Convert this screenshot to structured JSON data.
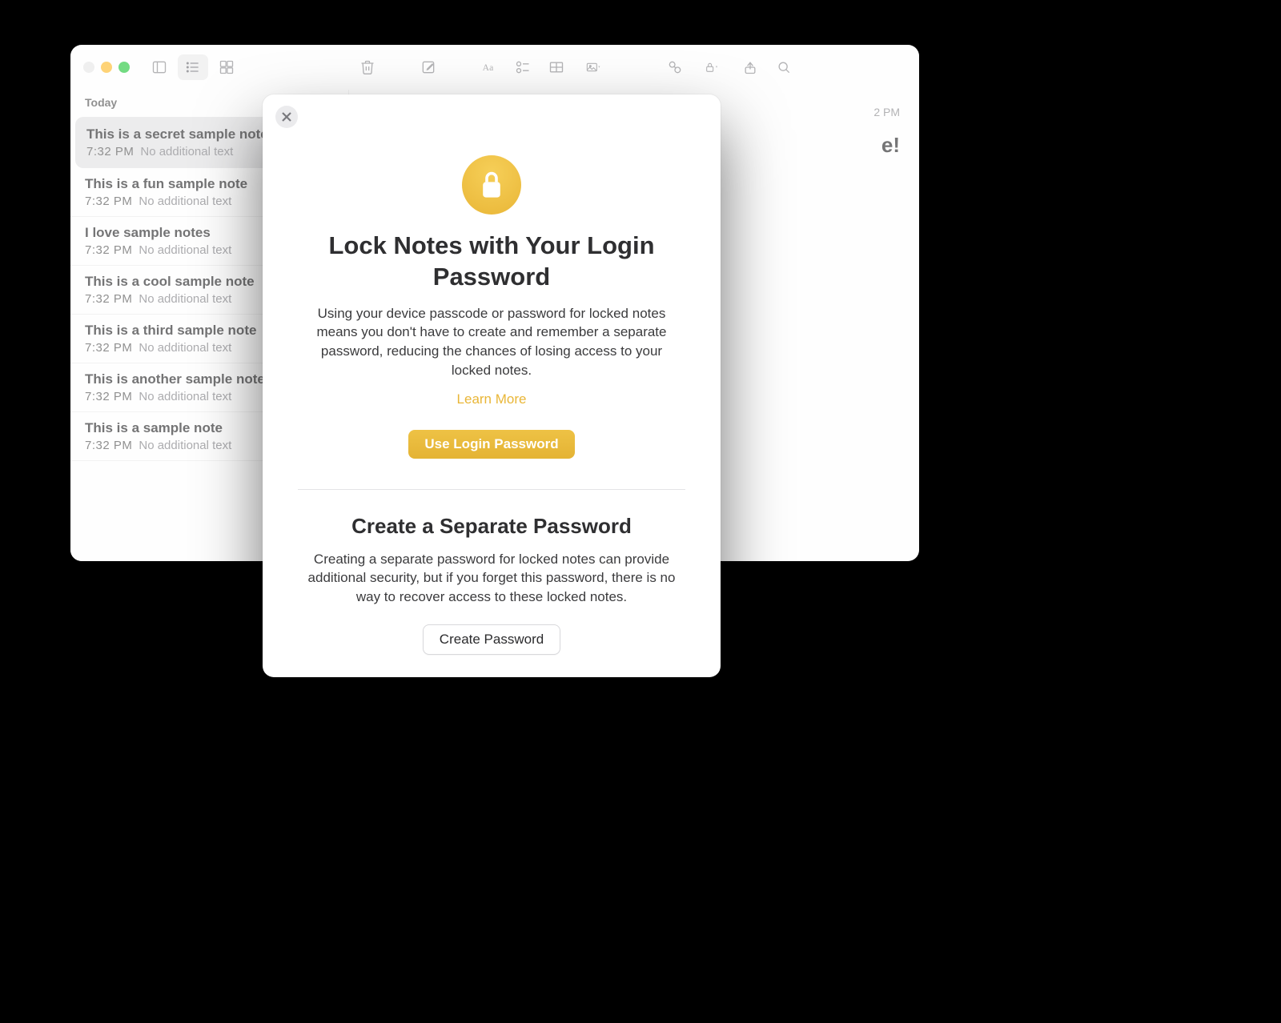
{
  "sidebar": {
    "section": "Today"
  },
  "notes": [
    {
      "title": "This is a secret sample note",
      "time": "7:32 PM",
      "preview": "No additional text"
    },
    {
      "title": "This is a fun sample note",
      "time": "7:32 PM",
      "preview": "No additional text"
    },
    {
      "title": "I love sample notes",
      "time": "7:32 PM",
      "preview": "No additional text"
    },
    {
      "title": "This is a cool sample note",
      "time": "7:32 PM",
      "preview": "No additional text"
    },
    {
      "title": "This is a third sample note",
      "time": "7:32 PM",
      "preview": "No additional text"
    },
    {
      "title": "This is another sample note",
      "time": "7:32 PM",
      "preview": "No additional text"
    },
    {
      "title": "This is a sample note",
      "time": "7:32 PM",
      "preview": "No additional text"
    }
  ],
  "editor": {
    "date_suffix": "2 PM",
    "title_suffix": "e!"
  },
  "modal": {
    "heading": "Lock Notes with Your Login Password",
    "body1": "Using your device passcode or password for locked notes means you don't have to create and remember a separate password, reducing the chances of losing access to your locked notes.",
    "learn_more": "Learn More",
    "primary": "Use Login Password",
    "heading2": "Create a Separate Password",
    "body2": "Creating a separate password for locked notes can provide additional security, but if you forget this password, there is no way to recover access to these locked notes.",
    "secondary": "Create Password"
  }
}
